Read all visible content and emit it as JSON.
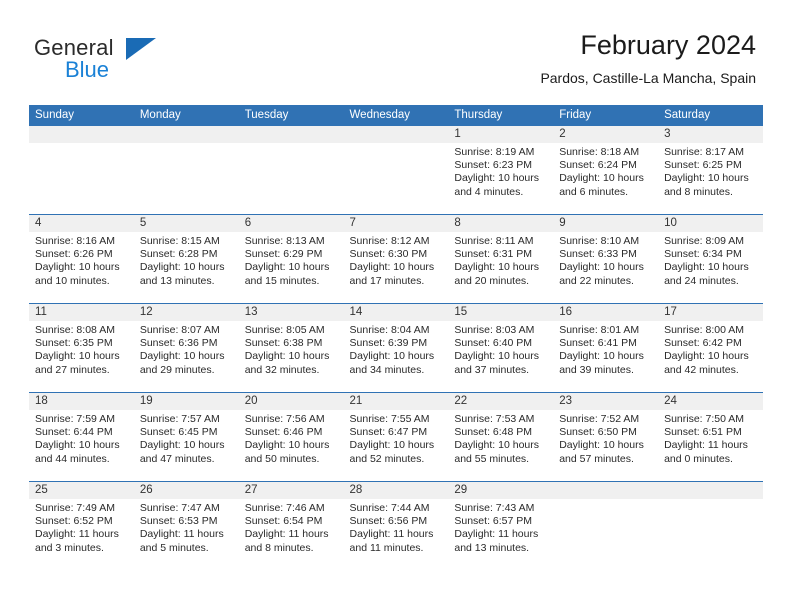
{
  "brand": {
    "name_part1": "General",
    "name_part2": "Blue",
    "logo_icon": "triangle-flag-icon"
  },
  "header": {
    "title": "February 2024",
    "subtitle": "Pardos, Castille-La Mancha, Spain"
  },
  "colors": {
    "header_blue": "#3072b4",
    "brand_blue": "#1a81d6",
    "daynum_band": "#f0f0f0"
  },
  "weekdays": [
    "Sunday",
    "Monday",
    "Tuesday",
    "Wednesday",
    "Thursday",
    "Friday",
    "Saturday"
  ],
  "weeks": [
    [
      {
        "day": "",
        "empty": true
      },
      {
        "day": "",
        "empty": true
      },
      {
        "day": "",
        "empty": true
      },
      {
        "day": "",
        "empty": true
      },
      {
        "day": "1",
        "sunrise": "Sunrise: 8:19 AM",
        "sunset": "Sunset: 6:23 PM",
        "daylight1": "Daylight: 10 hours",
        "daylight2": "and 4 minutes."
      },
      {
        "day": "2",
        "sunrise": "Sunrise: 8:18 AM",
        "sunset": "Sunset: 6:24 PM",
        "daylight1": "Daylight: 10 hours",
        "daylight2": "and 6 minutes."
      },
      {
        "day": "3",
        "sunrise": "Sunrise: 8:17 AM",
        "sunset": "Sunset: 6:25 PM",
        "daylight1": "Daylight: 10 hours",
        "daylight2": "and 8 minutes."
      }
    ],
    [
      {
        "day": "4",
        "sunrise": "Sunrise: 8:16 AM",
        "sunset": "Sunset: 6:26 PM",
        "daylight1": "Daylight: 10 hours",
        "daylight2": "and 10 minutes."
      },
      {
        "day": "5",
        "sunrise": "Sunrise: 8:15 AM",
        "sunset": "Sunset: 6:28 PM",
        "daylight1": "Daylight: 10 hours",
        "daylight2": "and 13 minutes."
      },
      {
        "day": "6",
        "sunrise": "Sunrise: 8:13 AM",
        "sunset": "Sunset: 6:29 PM",
        "daylight1": "Daylight: 10 hours",
        "daylight2": "and 15 minutes."
      },
      {
        "day": "7",
        "sunrise": "Sunrise: 8:12 AM",
        "sunset": "Sunset: 6:30 PM",
        "daylight1": "Daylight: 10 hours",
        "daylight2": "and 17 minutes."
      },
      {
        "day": "8",
        "sunrise": "Sunrise: 8:11 AM",
        "sunset": "Sunset: 6:31 PM",
        "daylight1": "Daylight: 10 hours",
        "daylight2": "and 20 minutes."
      },
      {
        "day": "9",
        "sunrise": "Sunrise: 8:10 AM",
        "sunset": "Sunset: 6:33 PM",
        "daylight1": "Daylight: 10 hours",
        "daylight2": "and 22 minutes."
      },
      {
        "day": "10",
        "sunrise": "Sunrise: 8:09 AM",
        "sunset": "Sunset: 6:34 PM",
        "daylight1": "Daylight: 10 hours",
        "daylight2": "and 24 minutes."
      }
    ],
    [
      {
        "day": "11",
        "sunrise": "Sunrise: 8:08 AM",
        "sunset": "Sunset: 6:35 PM",
        "daylight1": "Daylight: 10 hours",
        "daylight2": "and 27 minutes."
      },
      {
        "day": "12",
        "sunrise": "Sunrise: 8:07 AM",
        "sunset": "Sunset: 6:36 PM",
        "daylight1": "Daylight: 10 hours",
        "daylight2": "and 29 minutes."
      },
      {
        "day": "13",
        "sunrise": "Sunrise: 8:05 AM",
        "sunset": "Sunset: 6:38 PM",
        "daylight1": "Daylight: 10 hours",
        "daylight2": "and 32 minutes."
      },
      {
        "day": "14",
        "sunrise": "Sunrise: 8:04 AM",
        "sunset": "Sunset: 6:39 PM",
        "daylight1": "Daylight: 10 hours",
        "daylight2": "and 34 minutes."
      },
      {
        "day": "15",
        "sunrise": "Sunrise: 8:03 AM",
        "sunset": "Sunset: 6:40 PM",
        "daylight1": "Daylight: 10 hours",
        "daylight2": "and 37 minutes."
      },
      {
        "day": "16",
        "sunrise": "Sunrise: 8:01 AM",
        "sunset": "Sunset: 6:41 PM",
        "daylight1": "Daylight: 10 hours",
        "daylight2": "and 39 minutes."
      },
      {
        "day": "17",
        "sunrise": "Sunrise: 8:00 AM",
        "sunset": "Sunset: 6:42 PM",
        "daylight1": "Daylight: 10 hours",
        "daylight2": "and 42 minutes."
      }
    ],
    [
      {
        "day": "18",
        "sunrise": "Sunrise: 7:59 AM",
        "sunset": "Sunset: 6:44 PM",
        "daylight1": "Daylight: 10 hours",
        "daylight2": "and 44 minutes."
      },
      {
        "day": "19",
        "sunrise": "Sunrise: 7:57 AM",
        "sunset": "Sunset: 6:45 PM",
        "daylight1": "Daylight: 10 hours",
        "daylight2": "and 47 minutes."
      },
      {
        "day": "20",
        "sunrise": "Sunrise: 7:56 AM",
        "sunset": "Sunset: 6:46 PM",
        "daylight1": "Daylight: 10 hours",
        "daylight2": "and 50 minutes."
      },
      {
        "day": "21",
        "sunrise": "Sunrise: 7:55 AM",
        "sunset": "Sunset: 6:47 PM",
        "daylight1": "Daylight: 10 hours",
        "daylight2": "and 52 minutes."
      },
      {
        "day": "22",
        "sunrise": "Sunrise: 7:53 AM",
        "sunset": "Sunset: 6:48 PM",
        "daylight1": "Daylight: 10 hours",
        "daylight2": "and 55 minutes."
      },
      {
        "day": "23",
        "sunrise": "Sunrise: 7:52 AM",
        "sunset": "Sunset: 6:50 PM",
        "daylight1": "Daylight: 10 hours",
        "daylight2": "and 57 minutes."
      },
      {
        "day": "24",
        "sunrise": "Sunrise: 7:50 AM",
        "sunset": "Sunset: 6:51 PM",
        "daylight1": "Daylight: 11 hours",
        "daylight2": "and 0 minutes."
      }
    ],
    [
      {
        "day": "25",
        "sunrise": "Sunrise: 7:49 AM",
        "sunset": "Sunset: 6:52 PM",
        "daylight1": "Daylight: 11 hours",
        "daylight2": "and 3 minutes."
      },
      {
        "day": "26",
        "sunrise": "Sunrise: 7:47 AM",
        "sunset": "Sunset: 6:53 PM",
        "daylight1": "Daylight: 11 hours",
        "daylight2": "and 5 minutes."
      },
      {
        "day": "27",
        "sunrise": "Sunrise: 7:46 AM",
        "sunset": "Sunset: 6:54 PM",
        "daylight1": "Daylight: 11 hours",
        "daylight2": "and 8 minutes."
      },
      {
        "day": "28",
        "sunrise": "Sunrise: 7:44 AM",
        "sunset": "Sunset: 6:56 PM",
        "daylight1": "Daylight: 11 hours",
        "daylight2": "and 11 minutes."
      },
      {
        "day": "29",
        "sunrise": "Sunrise: 7:43 AM",
        "sunset": "Sunset: 6:57 PM",
        "daylight1": "Daylight: 11 hours",
        "daylight2": "and 13 minutes."
      },
      {
        "day": "",
        "empty": true
      },
      {
        "day": "",
        "empty": true
      }
    ]
  ]
}
